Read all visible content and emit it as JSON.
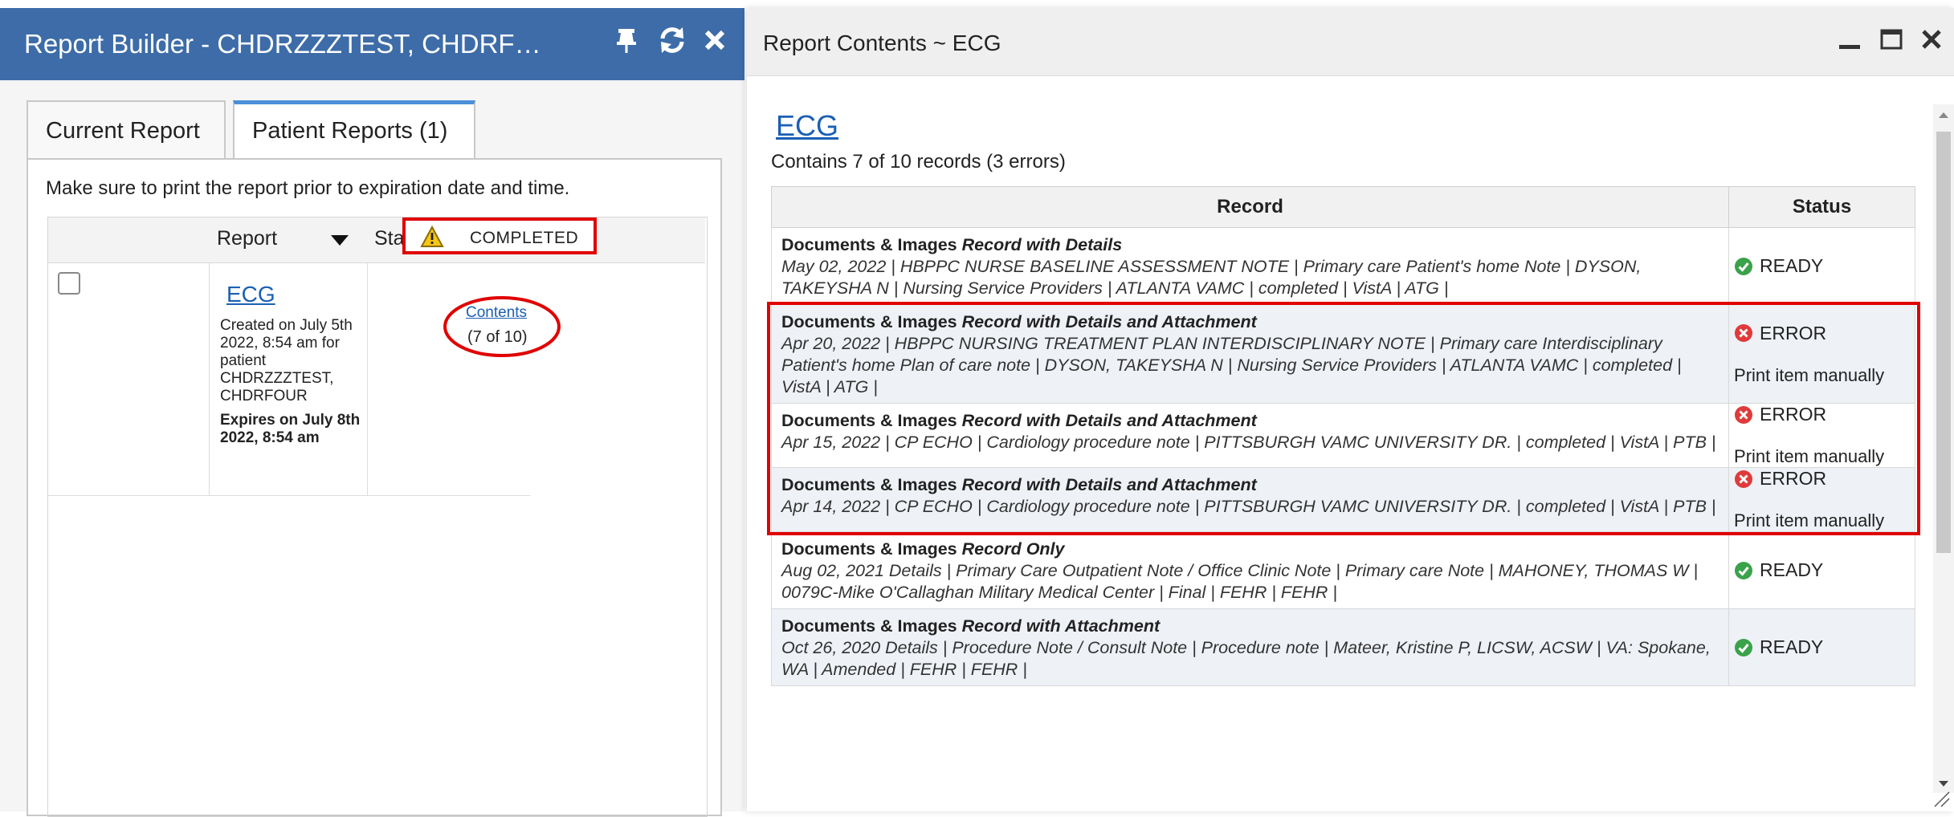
{
  "left_panel": {
    "title": "Report Builder - CHDRZZZTEST, CHDRF…",
    "tabs": [
      {
        "label": "Current Report",
        "active": false
      },
      {
        "label": "Patient Reports (1)",
        "active": true
      }
    ],
    "notice": "Make sure to print the report prior to expiration date and time.",
    "table_headers": {
      "report": "Report",
      "status": "Status"
    },
    "row": {
      "name": "ECG",
      "created": "Created on July 5th 2022, 8:54 am for patient CHDRZZZTEST, CHDRFOUR",
      "expires": "Expires on July 8th 2022, 8:54 am",
      "status": "COMPLETED",
      "contents_link": "Contents",
      "contents_count": "(7 of 10)"
    }
  },
  "right_panel": {
    "title": "Report Contents ~ ECG",
    "heading": "ECG",
    "summary": "Contains 7 of 10 records (3 errors)",
    "columns": {
      "record": "Record",
      "status": "Status"
    },
    "records": [
      {
        "category": "Documents & Images",
        "type": "Record with Details",
        "details": "May 02, 2022  |  HBPPC NURSE BASELINE ASSESSMENT NOTE  |  Primary care Patient's home Note  |  DYSON, TAKEYSHA N  |  Nursing Service Providers  |  ATLANTA VAMC  |  completed  |  VistA  |  ATG  |",
        "status": "READY",
        "note": ""
      },
      {
        "category": "Documents & Images",
        "type": "Record with Details and Attachment",
        "details": "Apr 20, 2022  |  HBPPC NURSING TREATMENT PLAN INTERDISCIPLINARY NOTE  |  Primary care Interdisciplinary Patient's home Plan of care note  |  DYSON, TAKEYSHA N  |  Nursing Service Providers  |  ATLANTA VAMC  |  completed  |  VistA  |  ATG  |",
        "status": "ERROR",
        "note": "Print item manually"
      },
      {
        "category": "Documents & Images",
        "type": "Record with Details and Attachment",
        "details": "Apr 15, 2022  |  CP ECHO  |  Cardiology procedure note  |  PITTSBURGH VAMC UNIVERSITY DR.  |  completed  |  VistA  |  PTB  |",
        "status": "ERROR",
        "note": "Print item manually"
      },
      {
        "category": "Documents & Images",
        "type": "Record with Details and Attachment",
        "details": "Apr 14, 2022  |  CP ECHO  |  Cardiology procedure note  |  PITTSBURGH VAMC UNIVERSITY DR.  |  completed  |  VistA  |  PTB  |",
        "status": "ERROR",
        "note": "Print item manually"
      },
      {
        "category": "Documents & Images",
        "type": "Record Only",
        "details": "Aug 02, 2021 Details  |  Primary Care Outpatient Note / Office Clinic Note  |  Primary care Note  |  MAHONEY, THOMAS W  |  0079C-Mike O'Callaghan Military Medical Center  |  Final  |  FEHR  |  FEHR  |",
        "status": "READY",
        "note": ""
      },
      {
        "category": "Documents & Images",
        "type": "Record with Attachment",
        "details": "Oct 26, 2020 Details  |  Procedure Note / Consult Note  |  Procedure note  |  Mateer, Kristine P, LICSW, ACSW  |  VA: Spokane, WA  |  Amended  |  FEHR  |  FEHR  |",
        "status": "READY",
        "note": ""
      }
    ]
  },
  "colors": {
    "header_blue": "#3d6ca8",
    "link_blue": "#1a5fb4",
    "highlight_red": "#e00000",
    "ready_green": "#3aa24a",
    "error_red": "#e03a3a",
    "warning_yellow": "#f5c518"
  },
  "icons": {
    "left_header": [
      "pin-icon",
      "refresh-icon",
      "close-icon"
    ],
    "right_header": [
      "minimize-icon",
      "maximize-icon",
      "close-icon"
    ],
    "status": {
      "READY": "check-circle-icon",
      "ERROR": "x-circle-icon",
      "COMPLETED": "warning-triangle-icon"
    }
  }
}
